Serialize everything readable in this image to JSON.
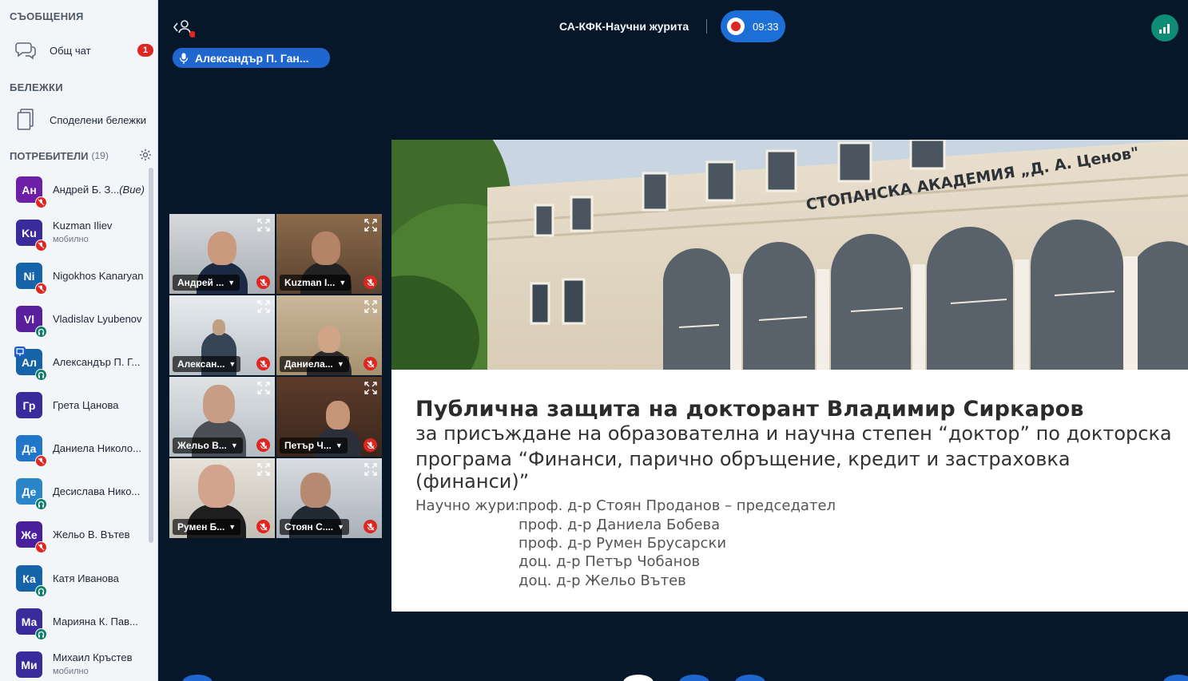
{
  "sidebar": {
    "messages_title": "СЪОБЩЕНИЯ",
    "public_chat": {
      "label": "Общ чат",
      "unread": "1"
    },
    "notes_title": "БЕЛЕЖКИ",
    "shared_notes": {
      "label": "Споделени бележки"
    },
    "users_title": "ПОТРЕБИТЕЛИ",
    "users_count": "(19)",
    "users": [
      {
        "initials": "Ан",
        "name": "Андрей Б. З...",
        "tag": "(Вие)",
        "color": "#6d1fa8",
        "status": "red"
      },
      {
        "initials": "Ku",
        "name": "Kuzman Iliev",
        "sub": "мобилно",
        "color": "#3a2a9c",
        "status": "red"
      },
      {
        "initials": "Ni",
        "name": "Nigokhos Kanaryan",
        "color": "#1563a8",
        "status": "red"
      },
      {
        "initials": "Vl",
        "name": "Vladislav Lyubenov",
        "color": "#5a1f9c",
        "status": "teal"
      },
      {
        "initials": "Ал",
        "name": "Александър П. Г...",
        "color": "#1563a8",
        "status": "teal",
        "presenter": true
      },
      {
        "initials": "Гр",
        "name": "Грета Цанова",
        "color": "#3a2a9c",
        "status": "none"
      },
      {
        "initials": "Да",
        "name": "Даниела Николо...",
        "color": "#2276c9",
        "status": "red"
      },
      {
        "initials": "Де",
        "name": "Десислава Нико...",
        "color": "#2a86c9",
        "status": "teal"
      },
      {
        "initials": "Же",
        "name": "Жельо В. Вътев",
        "color": "#4a1f9c",
        "status": "red"
      },
      {
        "initials": "Ка",
        "name": "Катя Иванова",
        "color": "#1563a8",
        "status": "teal"
      },
      {
        "initials": "Ма",
        "name": "Марияна К. Пав...",
        "color": "#3a2a9c",
        "status": "teal"
      },
      {
        "initials": "Ми",
        "name": "Михаил Кръстев",
        "sub": "мобилно",
        "color": "#3a2a9c",
        "status": "none"
      }
    ]
  },
  "topbar": {
    "room_title": "СА-КФК-Научни журита",
    "recording_time": "09:33",
    "talker": "Александър П. Ган..."
  },
  "videos": [
    {
      "name": "Андрей ..."
    },
    {
      "name": "Kuzman I..."
    },
    {
      "name": "Алексан..."
    },
    {
      "name": "Даниела..."
    },
    {
      "name": "Жельо В..."
    },
    {
      "name": "Петър Ч..."
    },
    {
      "name": "Румен Б..."
    },
    {
      "name": "Стоян С...."
    }
  ],
  "slide": {
    "building_sign": "СТОПАНСКА АКАДЕМИЯ „Д. А. Ценов\"",
    "title": "Публична защита на докторант Владимир Сиркаров",
    "subtitle_line1": "за присъждане на образователна и научна степен “доктор” по докторска",
    "subtitle_line2": "програма “Финанси, парично обръщение, кредит и застраховка (финанси)”",
    "jury_label": "Научно жури:",
    "jury": [
      "проф. д-р Стоян Проданов – председател",
      "проф. д-р Даниела Бобева",
      "проф. д-р Румен Брусарски",
      "доц. д-р Петър Чобанов",
      "доц. д-р Жельо Вътев"
    ]
  },
  "colors": {
    "background": "#06172a",
    "accent": "#1b6fd6",
    "muted_red": "#df2721",
    "connection": "#0f8c76"
  }
}
